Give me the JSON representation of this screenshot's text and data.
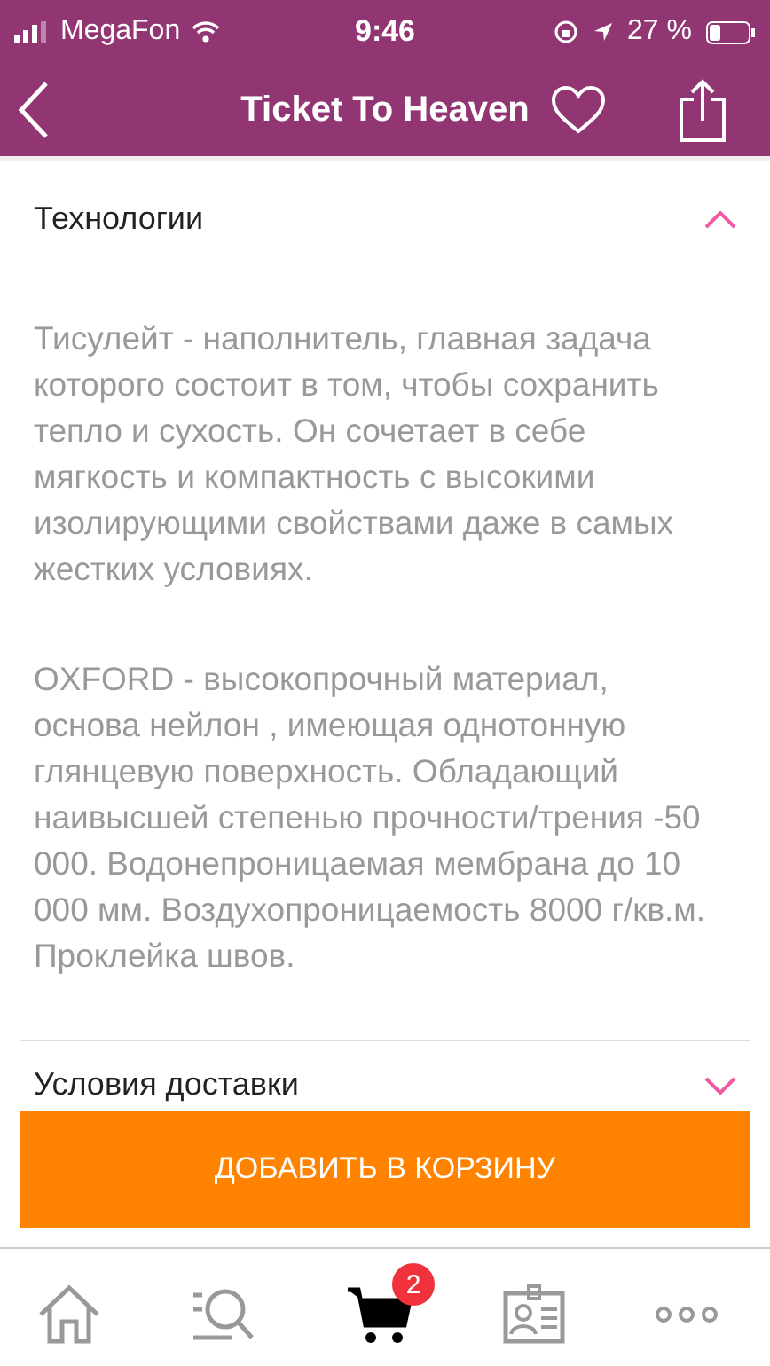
{
  "status_bar": {
    "carrier": "MegaFon",
    "time": "9:46",
    "battery_text": "27 %"
  },
  "header": {
    "title": "Ticket To Heaven"
  },
  "sections": [
    {
      "title": "Технологии",
      "expanded": true,
      "paragraphs": [
        "Тисулейт - наполнитель, главная задача которого состоит в том, чтобы сохранить тепло и сухость. Он сочетает в себе мягкость и компактность с высокими изолирующими свойствами даже в самых жестких условиях.",
        "OXFORD - высокопрочный материал, основа нейлон , имеющая однотонную глянцевую поверхность. Обладающий наивысшей степенью прочности/трения -50 000. Водонепроницаемая мембрана до 10 000 мм. Воздухопроницаемость 8000 г/кв.м. Проклейка швов."
      ]
    },
    {
      "title": "Условия доставки",
      "expanded": false
    }
  ],
  "cart_button": "ДОБАВИТЬ В КОРЗИНУ",
  "tab_bar": [
    {
      "kind": "home",
      "selected": false
    },
    {
      "kind": "search",
      "selected": false
    },
    {
      "kind": "cart",
      "selected": true,
      "badge": "2"
    },
    {
      "kind": "profile",
      "selected": false
    },
    {
      "kind": "more",
      "selected": false
    }
  ]
}
